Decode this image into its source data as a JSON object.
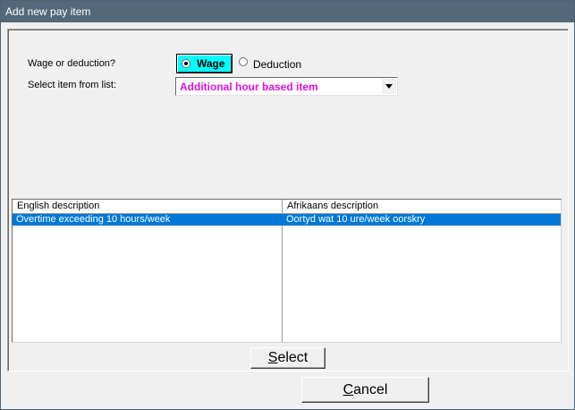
{
  "window": {
    "title": "Add new pay item"
  },
  "form": {
    "type_label": "Wage or deduction?",
    "item_label": "Select item from list:",
    "options": [
      {
        "label": "Wage",
        "selected": true
      },
      {
        "label": "Deduction",
        "selected": false
      }
    ],
    "selected_item": "Additional hour based item"
  },
  "table": {
    "columns": [
      "English description",
      "Afrikaans description"
    ],
    "rows": [
      {
        "english": "Overtime exceeding 10 hours/week",
        "afrikaans": "Oortyd wat 10 ure/week oorskry",
        "selected": true
      }
    ]
  },
  "buttons": {
    "select_mnemonic": "S",
    "select_rest": "elect",
    "cancel_mnemonic": "C",
    "cancel_rest": "ancel"
  },
  "colors": {
    "title_bar": "#536878",
    "selected_radio_bg": "#00ffff",
    "combo_text": "#e010e0",
    "row_highlight": "#0078d7"
  }
}
